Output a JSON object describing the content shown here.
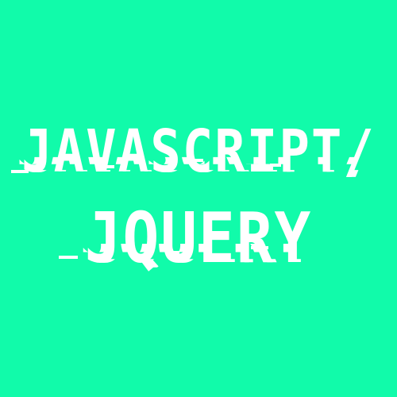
{
  "background_color": "#11FBAA",
  "text_color": "#FFFFFF",
  "title": {
    "line1": "JAVASCRIPT/",
    "line2": "JQUERY"
  }
}
